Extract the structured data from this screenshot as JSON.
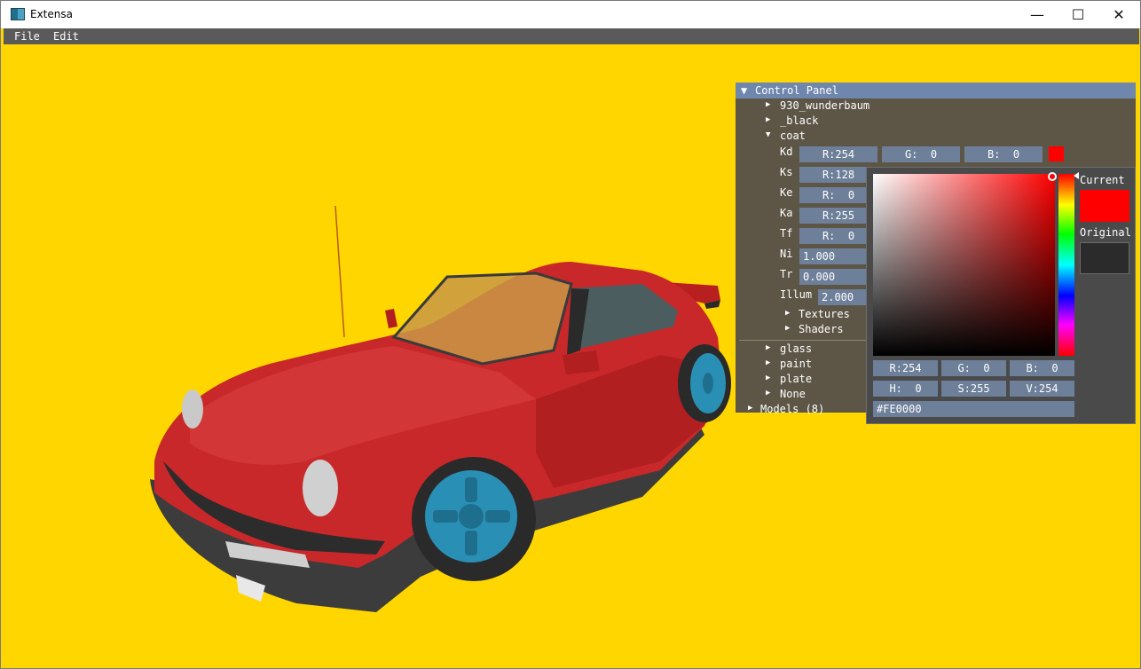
{
  "window": {
    "title": "Extensa",
    "min_glyph": "—",
    "max_glyph": "☐",
    "close_glyph": "✕"
  },
  "menu": {
    "file": "File",
    "edit": "Edit"
  },
  "panel": {
    "title": "Control Panel",
    "expand_glyph": "▼",
    "collapsed_glyph": "▶",
    "items": [
      {
        "label": "930_wunderbaum"
      },
      {
        "label": "_black"
      },
      {
        "label": "coat"
      }
    ],
    "coat": {
      "kd": {
        "label": "Kd",
        "r": "R:254",
        "g": "G:  0",
        "b": "B:  0",
        "swatch": "#fe0000"
      },
      "ks": {
        "label": "Ks",
        "r": "R:128"
      },
      "ke": {
        "label": "Ke",
        "r": "R:  0"
      },
      "ka": {
        "label": "Ka",
        "r": "R:255"
      },
      "tf": {
        "label": "Tf",
        "r": "R:  0"
      },
      "ni": {
        "label": "Ni",
        "value": "1.000"
      },
      "tr": {
        "label": "Tr",
        "value": "0.000"
      },
      "illum": {
        "label": "Illum",
        "value": "2.000"
      },
      "textures": "Textures",
      "shaders": "Shaders"
    },
    "more_items": [
      {
        "label": "glass"
      },
      {
        "label": "paint"
      },
      {
        "label": "plate"
      },
      {
        "label": "None"
      }
    ],
    "models": "Models (8)"
  },
  "picker": {
    "current_label": "Current",
    "original_label": "Original",
    "current_color": "#fe0000",
    "original_color": "#2b2b2b",
    "r": "R:254",
    "g": "G:  0",
    "b": "B:  0",
    "h": "H:  0",
    "s": "S:255",
    "v": "V:254",
    "hex": "#FE0000"
  },
  "colors": {
    "background": "#ffd600",
    "car_body": "#c8282a",
    "wheel": "#2a8fb4",
    "panel_header": "#6f87ad",
    "field": "#6d7f99"
  }
}
